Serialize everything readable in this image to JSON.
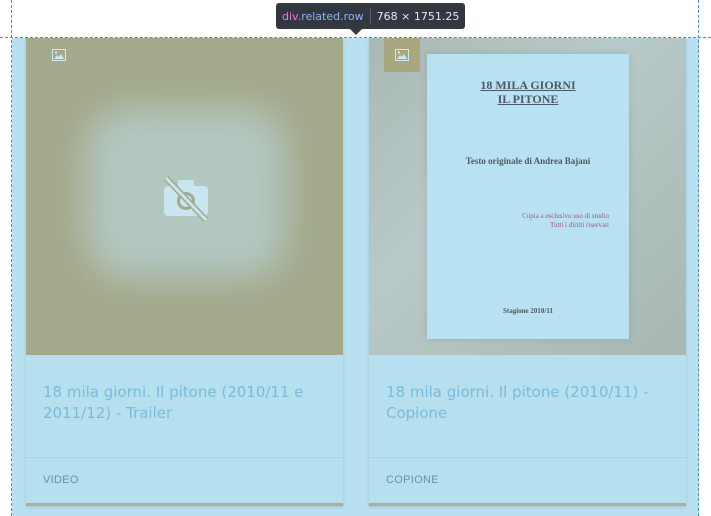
{
  "devtools": {
    "tag": "div",
    "classes": ".related.row",
    "dimensions": "768 × 1751.25"
  },
  "cards": [
    {
      "title": "18 mila giorni. Il pitone (2010/11 e 2011/12) - Trailer",
      "category": "VIDEO",
      "thumbnail_icon": "no-camera-icon",
      "type_icon": "image-icon"
    },
    {
      "title": "18 mila giorni. Il pitone (2010/11) - Copione",
      "category": "COPIONE",
      "type_icon": "image-icon",
      "document": {
        "title_line1": "18 MILA GIORNI",
        "title_line2": "IL PITONE",
        "subtitle": "Testo originale di Andrea Bajani",
        "note_line1": "Copia a esclusivo uso di studio",
        "note_line2": "Tutti i diritti riservati",
        "footer": "Stagione 2010/11"
      }
    }
  ],
  "colors": {
    "highlight": "#b9e0f1",
    "tooltip_bg": "#333740",
    "card_border": "#b2ad8d"
  }
}
